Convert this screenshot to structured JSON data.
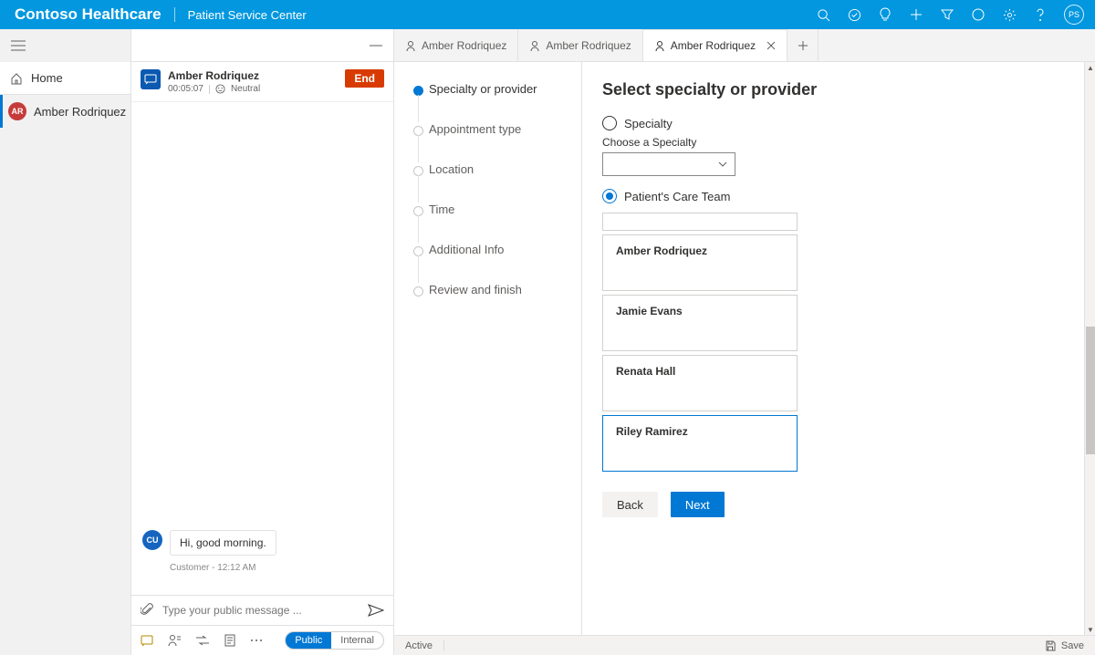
{
  "header": {
    "brand": "Contoso Healthcare",
    "app_title": "Patient Service Center",
    "avatar_initials": "PS"
  },
  "left_nav": {
    "home_label": "Home",
    "contact_label": "Amber Rodriquez",
    "contact_initials": "AR"
  },
  "chat": {
    "name": "Amber Rodriquez",
    "timer": "00:05:07",
    "sentiment": "Neutral",
    "end_label": "End",
    "message_initials": "CU",
    "message_text": "Hi, good morning.",
    "message_meta": "Customer - 12:12 AM",
    "compose_placeholder": "Type your public message ...",
    "pill_public": "Public",
    "pill_internal": "Internal"
  },
  "tabs": [
    {
      "label": "Amber Rodriquez",
      "active": false
    },
    {
      "label": "Amber Rodriquez",
      "active": false
    },
    {
      "label": "Amber Rodriquez",
      "active": true
    }
  ],
  "stepper": [
    "Specialty or provider",
    "Appointment type",
    "Location",
    "Time",
    "Additional Info",
    "Review and finish"
  ],
  "form": {
    "title": "Select specialty or provider",
    "radio_specialty": "Specialty",
    "specialty_label": "Choose a Specialty",
    "radio_care_team": "Patient's Care Team",
    "care_team": [
      "Amber Rodriquez",
      "Jamie Evans",
      "Renata Hall",
      "Riley Ramirez"
    ],
    "back_label": "Back",
    "next_label": "Next"
  },
  "statusbar": {
    "status": "Active",
    "save": "Save"
  }
}
